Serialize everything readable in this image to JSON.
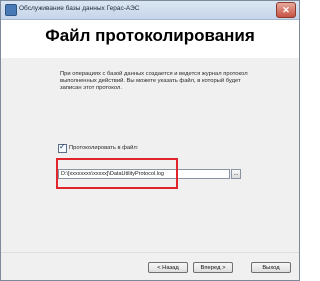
{
  "window": {
    "title": "Обслуживание базы данных Герас-АЭС",
    "close_icon": "close-icon"
  },
  "header": {
    "title": "Файл протоколирования"
  },
  "main": {
    "description": "При операциях с базой данных создается и ведется журнал протокол выполненных действий. Вы можете указать файл, в который будет записан этот протокол.",
    "checkbox": {
      "checked": true,
      "label": "Протоколировать в файл:"
    },
    "path_input": {
      "value": "D:\\[xxxxxxxx\\xxxxx]\\DataUtilityProtocol.log"
    },
    "browse_label": "..."
  },
  "footer": {
    "back_label": "< Назад",
    "next_label": "Вперед >",
    "exit_label": "Выход"
  },
  "colors": {
    "highlight": "#e0262b",
    "titlebar": "#c5d5ea"
  }
}
